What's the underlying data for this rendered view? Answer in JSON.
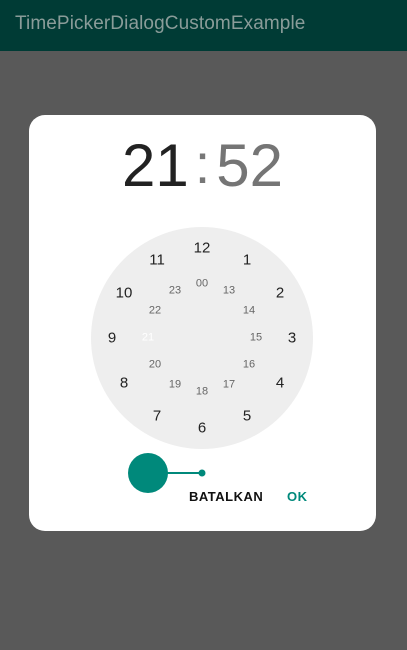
{
  "appbar": {
    "title": "TimePickerDialogCustomExample"
  },
  "time": {
    "hour": "21",
    "separator": ":",
    "minute": "52"
  },
  "dial": {
    "outer": [
      "12",
      "1",
      "2",
      "3",
      "4",
      "5",
      "6",
      "7",
      "8",
      "9",
      "10",
      "11"
    ],
    "inner": [
      "00",
      "13",
      "14",
      "15",
      "16",
      "17",
      "18",
      "19",
      "20",
      "21",
      "22",
      "23"
    ],
    "selected": "21"
  },
  "buttons": {
    "cancel": "BATALKAN",
    "ok": "OK"
  },
  "colors": {
    "accent": "#00897b",
    "appbar": "#003b35",
    "scrim": "#595959",
    "dial_bg": "#eeeeee"
  }
}
